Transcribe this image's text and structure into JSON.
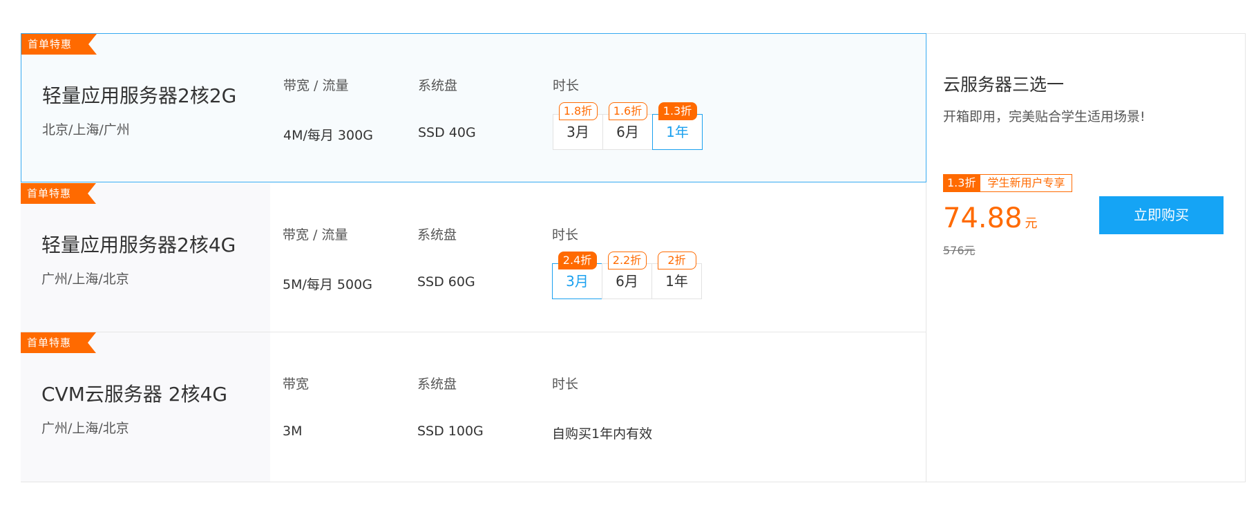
{
  "tag_label": "首单特惠",
  "headers": {
    "bandwidth_traffic": "带宽 / 流量",
    "bandwidth": "带宽",
    "disk": "系统盘",
    "duration": "时长"
  },
  "products": [
    {
      "name": "轻量应用服务器2核2G",
      "regions": "北京/上海/广州",
      "bandwidth": "4M/每月 300G",
      "disk": "SSD 40G",
      "durations": [
        {
          "label": "3月",
          "badge": "1.8折"
        },
        {
          "label": "6月",
          "badge": "1.6折"
        },
        {
          "label": "1年",
          "badge": "1.3折"
        }
      ]
    },
    {
      "name": "轻量应用服务器2核4G",
      "regions": "广州/上海/北京",
      "bandwidth": "5M/每月 500G",
      "disk": "SSD 60G",
      "durations": [
        {
          "label": "3月",
          "badge": "2.4折"
        },
        {
          "label": "6月",
          "badge": "2.2折"
        },
        {
          "label": "1年",
          "badge": "2折"
        }
      ]
    },
    {
      "name": "CVM云服务器 2核4G",
      "regions": "广州/上海/北京",
      "bandwidth": "3M",
      "disk": "SSD 100G",
      "duration_text": "自购买1年内有效"
    }
  ],
  "promo": {
    "title": "云服务器三选一",
    "subtitle": "开箱即用，完美贴合学生适用场景!",
    "discount": "1.3折",
    "note": "学生新用户专享",
    "price": "74.88",
    "price_unit": "元",
    "original_price": "576元",
    "buy_label": "立即购买"
  },
  "colors": {
    "accent_orange": "#ff6a00",
    "accent_blue": "#15a4f5",
    "selected_border": "#35a9f1"
  }
}
